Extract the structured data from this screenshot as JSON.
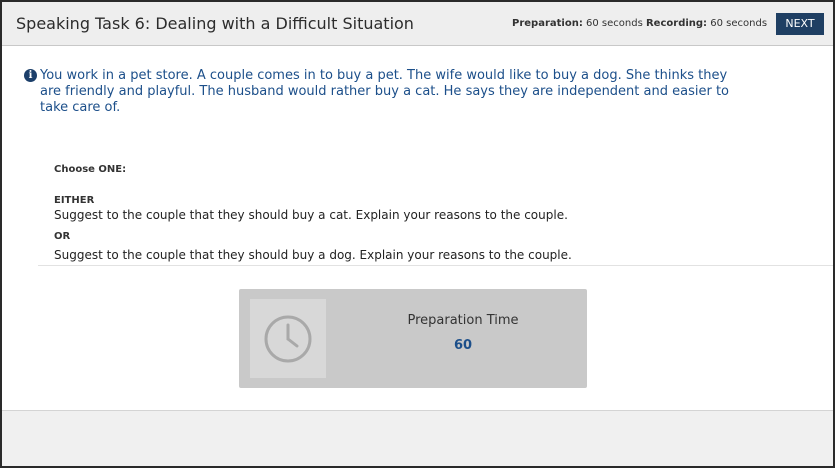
{
  "header": {
    "title": "Speaking Task 6: Dealing with a Difficult Situation",
    "preparation_label": "Preparation:",
    "preparation_value": "60 seconds",
    "recording_label": "Recording:",
    "recording_value": "60 seconds",
    "next_label": "NEXT"
  },
  "prompt": {
    "icon": "info-icon",
    "text": "You work in a pet store. A couple comes in to buy a pet. The wife would like to buy a dog. She thinks they are friendly and playful. The husband would rather buy a cat. He says they are independent and easier to take care of."
  },
  "task": {
    "choose": "Choose ONE:",
    "either": "EITHER",
    "option1": "Suggest to the couple that they should buy a cat. Explain your reasons to the couple.",
    "or": "OR",
    "option2": "Suggest to the couple that they should buy a dog. Explain your reasons to the couple."
  },
  "preparation_timer": {
    "icon": "clock-icon",
    "label": "Preparation Time",
    "value": "60"
  },
  "colors": {
    "accent": "#1f3f63",
    "prompt_text": "#1c4f8a",
    "timer_bg": "#c9c9c9"
  }
}
